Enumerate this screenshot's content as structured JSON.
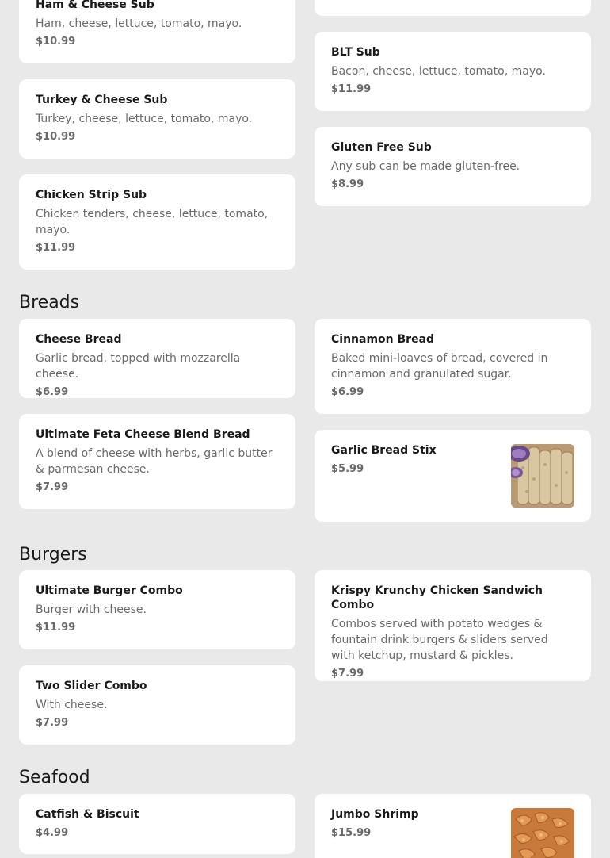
{
  "subs": [
    {
      "name": "Ham & Cheese Sub",
      "description": "Ham, cheese, lettuce, tomato, mayo.",
      "price": "$10.99"
    },
    {
      "name": "BLT Sub",
      "description": "Bacon, cheese, lettuce, tomato, mayo.",
      "price": "$11.99"
    },
    {
      "name": "Turkey & Cheese Sub",
      "description": "Turkey, cheese, lettuce, tomato, mayo.",
      "price": "$10.99"
    },
    {
      "name": "Gluten Free Sub",
      "description": "Any sub can be made gluten-free.",
      "price": "$8.99"
    },
    {
      "name": "Chicken Strip Sub",
      "description": "Chicken tenders, cheese, lettuce, tomato, mayo.",
      "price": "$11.99"
    }
  ],
  "sections": [
    {
      "title": "Breads",
      "items": [
        {
          "name": "Cheese Bread",
          "description": "Garlic bread, topped with mozzarella cheese.",
          "price": "$6.99"
        },
        {
          "name": "Cinnamon Bread",
          "description": "Baked mini-loaves of bread, covered in cinnamon and granulated sugar.",
          "price": "$6.99"
        },
        {
          "name": "Ultimate Feta Cheese Blend Bread",
          "description": "A blend of cheese with herbs, garlic butter & parmesan cheese.",
          "price": "$7.99"
        },
        {
          "name": "Garlic Bread Stix",
          "price": "$5.99",
          "image": "garlic-bread-photo"
        }
      ]
    },
    {
      "title": "Burgers",
      "items": [
        {
          "name": "Ultimate Burger Combo",
          "description": "Burger with cheese.",
          "price": "$11.99"
        },
        {
          "name": "Krispy Krunchy Chicken Sandwich Combo",
          "description": "Combos served with potato wedges & fountain drink burgers & sliders served with ketchup, mustard & pickles.",
          "price": "$7.99"
        },
        {
          "name": "Two Slider Combo",
          "description": "With cheese.",
          "price": "$7.99"
        }
      ]
    },
    {
      "title": "Seafood",
      "items": [
        {
          "name": "Catfish & Biscuit",
          "price": "$4.99"
        },
        {
          "name": "Jumbo Shrimp",
          "price": "$15.99",
          "image": "shrimp-photo"
        }
      ]
    }
  ],
  "colors": {
    "page_background": "#e9e9e9",
    "card_background": "#ffffff",
    "name_text": "#1a1a1a",
    "secondary_text": "#6a6a6a"
  }
}
